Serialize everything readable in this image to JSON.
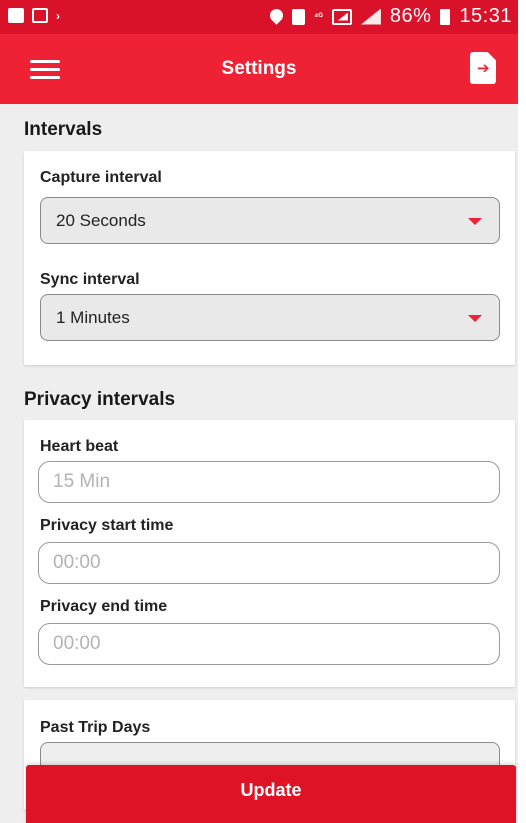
{
  "status_bar": {
    "signal_label": "⁴ᴳ",
    "battery_percent": "86%",
    "time": "15:31"
  },
  "app_bar": {
    "title": "Settings"
  },
  "intervals": {
    "section_title": "Intervals",
    "capture_label": "Capture interval",
    "capture_value": "20 Seconds",
    "sync_label": "Sync interval",
    "sync_value": "1 Minutes"
  },
  "privacy": {
    "section_title": "Privacy intervals",
    "heart_beat_label": "Heart beat",
    "heart_beat_placeholder": "15 Min",
    "start_label": "Privacy start time",
    "start_placeholder": "00:00",
    "end_label": "Privacy end time",
    "end_placeholder": "00:00"
  },
  "past_trips": {
    "label": "Past Trip Days"
  },
  "footer": {
    "update_label": "Update"
  },
  "colors": {
    "primary": "#ef2135",
    "status_bar": "#d9122a",
    "background": "#eeeeee"
  }
}
